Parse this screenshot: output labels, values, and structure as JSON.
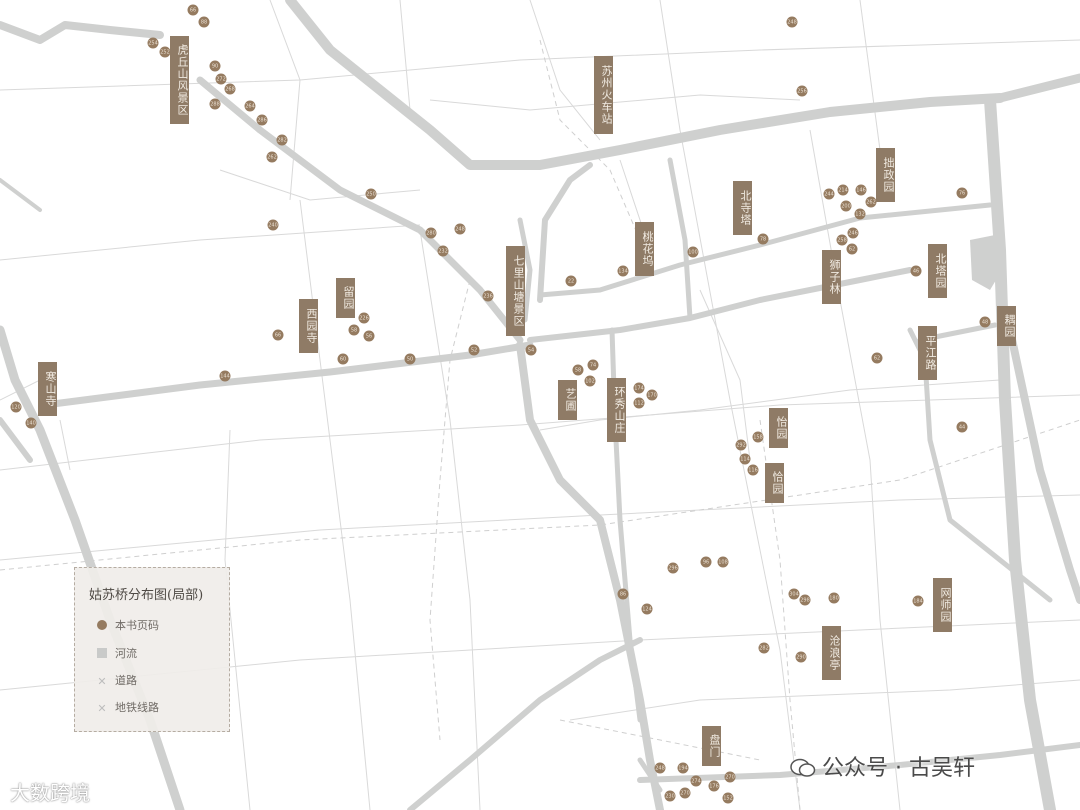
{
  "legend": {
    "title": "姑苏桥分布图(局部)",
    "items": [
      {
        "symbol": "dot-icon",
        "label": "本书页码"
      },
      {
        "symbol": "square-icon",
        "label": "河流"
      },
      {
        "symbol": "cross-icon",
        "label": "道路"
      },
      {
        "symbol": "cross-icon",
        "label": "地铁线路"
      }
    ]
  },
  "sites": [
    "虎丘山风景区",
    "苏州火车站",
    "拙政园",
    "北寺塔",
    "桃花坞",
    "七里山塘景区",
    "留园",
    "西园寺",
    "寒山寺",
    "北塔园",
    "狮子林",
    "耦园",
    "平江路",
    "艺圃",
    "环秀山庄",
    "怡园",
    "恰园",
    "网师园",
    "沧浪亭",
    "盘门"
  ],
  "page_numbers": [
    "66",
    "88",
    "254",
    "252",
    "90",
    "272",
    "268",
    "288",
    "264",
    "286",
    "282",
    "262",
    "248",
    "256",
    "250",
    "240",
    "280",
    "248",
    "232",
    "236",
    "244",
    "214",
    "146",
    "200",
    "262",
    "132",
    "246",
    "258",
    "62",
    "76",
    "46",
    "48",
    "62",
    "44",
    "78",
    "100",
    "134",
    "22",
    "226",
    "58",
    "56",
    "66",
    "60",
    "50",
    "52",
    "54",
    "58",
    "74",
    "102",
    "174",
    "170",
    "112",
    "144",
    "120",
    "140",
    "158",
    "292",
    "114",
    "116",
    "296",
    "96",
    "108",
    "86",
    "124",
    "304",
    "298",
    "180",
    "184",
    "282",
    "290",
    "248",
    "194",
    "274",
    "270",
    "230",
    "176",
    "270",
    "152",
    "174",
    "154",
    "150"
  ],
  "watermarks": {
    "left": "大数跨境",
    "right": "公众号 · 古吴轩"
  },
  "colors": {
    "river": "#cfd0cf",
    "road": "#d9d9d9",
    "pin": "#957b60",
    "site_label": "#8f7b66"
  }
}
